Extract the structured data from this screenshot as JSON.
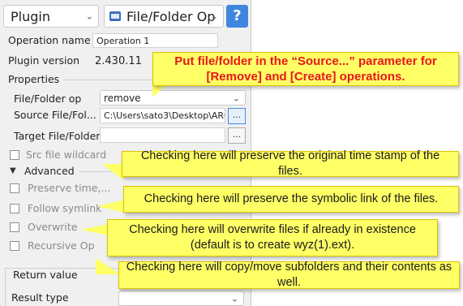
{
  "header": {
    "plugin_select": "Plugin",
    "op_select": "File/Folder Op",
    "help_label": "?"
  },
  "rows": {
    "operation_name_label": "Operation name",
    "operation_name_value": "Operation 1",
    "plugin_version_label": "Plugin version",
    "plugin_version_value": "2.430.11",
    "properties_label": "Properties",
    "file_folder_op_label": "File/Folder op",
    "file_folder_op_value": "remove",
    "source_label": "Source File/Fol...",
    "source_value": "C:\\Users\\sato3\\Desktop\\ARG",
    "target_label": "Target File/Folder",
    "browse_label": "...",
    "src_wildcard_label": "Src file wildcard",
    "advanced_label": "Advanced",
    "advanced_arrow": "▼",
    "preserve_time_label": "Preserve time,...",
    "follow_symlink_label": "Follow symlink",
    "overwrite_label": "Overwrite",
    "recursive_label": "Recursive Op",
    "return_value_label": "Return value",
    "result_type_label": "Result type"
  },
  "callouts": {
    "source": "Put file/folder in the “Source...” parameter for [Remove] and [Create] operations.",
    "preserve_time": "Checking here will preserve the original time stamp of the files.",
    "symlink": "Checking here will preserve the symbolic link of the files.",
    "overwrite": "Checking here will overwrite files if already in existence (default is to create wyz(1).ext).",
    "recursive": "Checking here will copy/move subfolders and their contents as well."
  }
}
